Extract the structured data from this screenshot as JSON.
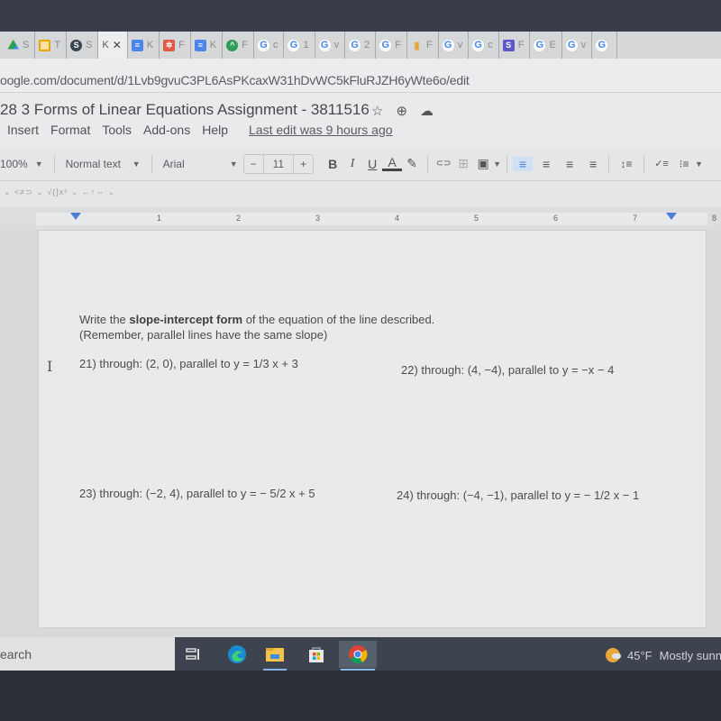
{
  "browser": {
    "tabs": [
      {
        "icon": "google-drive-icon",
        "label": "S",
        "cls": "ic-drive",
        "glyph": ""
      },
      {
        "icon": "google-slides-icon",
        "label": "T",
        "cls": "ic-slides",
        "glyph": ""
      },
      {
        "icon": "circle-s-icon",
        "label": "S",
        "cls": "ic-circle",
        "glyph": "S"
      },
      {
        "icon": "",
        "label": "K",
        "cls": "",
        "glyph": "",
        "active": true
      },
      {
        "icon": "google-docs-icon",
        "label": "K",
        "cls": "ic-doc",
        "glyph": "≡"
      },
      {
        "icon": "red-app-icon",
        "label": "F",
        "cls": "ic-red",
        "glyph": "✲"
      },
      {
        "icon": "google-docs-icon",
        "label": "K",
        "cls": "ic-doc",
        "glyph": "≡"
      },
      {
        "icon": "green-app-icon",
        "label": "F",
        "cls": "ic-green",
        "glyph": "^"
      },
      {
        "icon": "google-icon",
        "label": "c",
        "cls": "ic-g",
        "glyph": "G"
      },
      {
        "icon": "google-icon",
        "label": "1",
        "cls": "ic-g",
        "glyph": "G"
      },
      {
        "icon": "google-icon",
        "label": "v",
        "cls": "ic-g",
        "glyph": "G"
      },
      {
        "icon": "google-icon",
        "label": "2",
        "cls": "ic-g",
        "glyph": "G"
      },
      {
        "icon": "google-icon",
        "label": "F",
        "cls": "ic-g",
        "glyph": "G"
      },
      {
        "icon": "bar-chart-icon",
        "label": "F",
        "cls": "ic-bar",
        "glyph": "▮"
      },
      {
        "icon": "google-icon",
        "label": "v",
        "cls": "ic-g",
        "glyph": "G"
      },
      {
        "icon": "google-icon",
        "label": "c",
        "cls": "ic-g",
        "glyph": "G"
      },
      {
        "icon": "s-app-icon",
        "label": "F",
        "cls": "ic-s",
        "glyph": "S"
      },
      {
        "icon": "google-icon",
        "label": "E",
        "cls": "ic-g",
        "glyph": "G"
      },
      {
        "icon": "google-icon",
        "label": "v",
        "cls": "ic-g",
        "glyph": "G"
      },
      {
        "icon": "google-icon",
        "label": "",
        "cls": "ic-g",
        "glyph": "G"
      }
    ],
    "close_glyph": "✕",
    "url": "oogle.com/document/d/1Lvb9gvuC3PL6AsPKcaxW31hDvWC5kFluRJZH6yWte6o/edit"
  },
  "docs": {
    "title": "28 3 Forms of Linear Equations Assignment - 3811516",
    "title_icons": {
      "star": "☆",
      "move": "⊕",
      "cloud": "☁"
    },
    "menu": [
      "Insert",
      "Format",
      "Tools",
      "Add-ons",
      "Help"
    ],
    "last_edit": "Last edit was 9 hours ago",
    "toolbar": {
      "zoom": "100%",
      "style": "Normal text",
      "font": "Arial",
      "font_size": "11",
      "minus": "−",
      "plus": "+",
      "bold": "B",
      "italic": "I",
      "underline": "U",
      "text_color": "A",
      "highlight": "✎",
      "link": "⊂⊃",
      "comment": "⊞",
      "image": "▣",
      "align_left": "≡",
      "align_center": "≡",
      "align_right": "≡",
      "justify": "≡",
      "line_spacing": "↕≡",
      "checklist": "✓≡",
      "bullets": "⁝≡"
    },
    "equation_bar": "⌄  <≠⊃ ⌄  √(]x² ⌄   ←↑⇔ ⌄",
    "ruler_numbers": [
      "1",
      "2",
      "3",
      "4",
      "5",
      "6",
      "7",
      "8"
    ]
  },
  "document": {
    "intro_pre": "Write the ",
    "intro_bold": "slope-intercept form",
    "intro_post": " of the equation of the line described.",
    "intro_line2": "(Remember, parallel lines have the same slope)",
    "problems": [
      "21) through: (2, 0), parallel to y = 1/3 x + 3",
      "22) through: (4, −4), parallel to y = −x − 4",
      "23) through: (−2, 4), parallel to y = − 5/2 x + 5",
      "24) through: (−4, −1), parallel to y = − 1/2 x − 1"
    ],
    "cursor": "I"
  },
  "taskbar": {
    "search": "earch",
    "apps": [
      "task-view",
      "edge",
      "file-explorer",
      "microsoft-store",
      "chrome"
    ],
    "weather_temp": "45°F",
    "weather_desc": "Mostly sunny"
  }
}
